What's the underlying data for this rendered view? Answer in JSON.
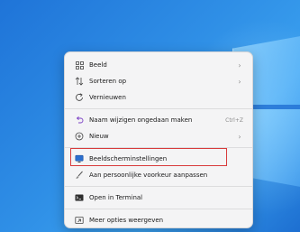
{
  "menu": {
    "items": [
      {
        "label": "Beeld",
        "icon": "grid-view-icon",
        "has_submenu": true
      },
      {
        "label": "Sorteren op",
        "icon": "sort-icon",
        "has_submenu": true
      },
      {
        "label": "Vernieuwen",
        "icon": "refresh-icon",
        "has_submenu": false
      },
      {
        "label": "Naam wijzigen ongedaan maken",
        "icon": "undo-icon",
        "shortcut": "Ctrl+Z"
      },
      {
        "label": "Nieuw",
        "icon": "new-plus-icon",
        "has_submenu": true
      },
      {
        "label": "Beeldscherminstellingen",
        "icon": "display-icon",
        "highlighted": true
      },
      {
        "label": "Aan persoonlijke voorkeur aanpassen",
        "icon": "brush-icon"
      },
      {
        "label": "Open in Terminal",
        "icon": "terminal-icon"
      },
      {
        "label": "Meer opties weergeven",
        "icon": "more-options-icon"
      }
    ]
  },
  "colors": {
    "highlight_border": "#d83b3b",
    "desktop_blue": "#2f8fe6",
    "menu_bg": "#f4f4f5"
  }
}
